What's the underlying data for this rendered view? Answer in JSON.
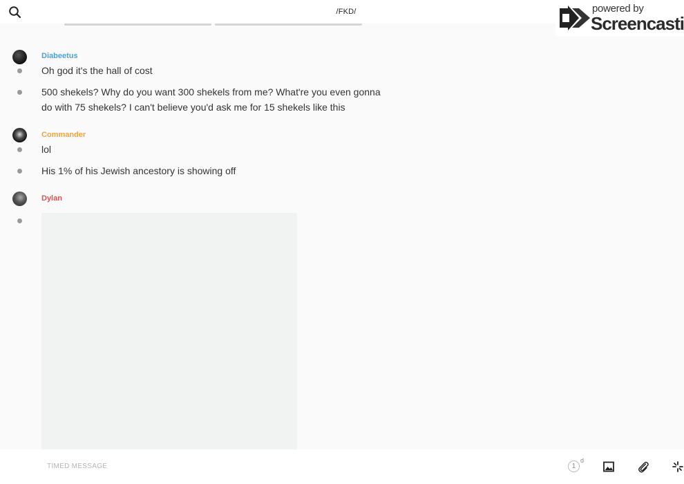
{
  "header": {
    "title": "/FKD/"
  },
  "watermark": {
    "line1": "powered by",
    "line2": "Screencastify"
  },
  "messages": {
    "groups": [
      {
        "sender": "Diabeetus",
        "color": "#4aa3d8",
        "items": [
          "Oh god it's the hall of cost",
          "500 shekels? Why do you want 300 shekels from me? What're you even gonna do with 75 shekels? I can't believe you'd ask me for 15 shekels like this"
        ]
      },
      {
        "sender": "Commander",
        "color": "#f0a43a",
        "items": [
          "lol",
          "His 1% of his Jewish ancestory is showing off"
        ]
      },
      {
        "sender": "Dylan",
        "color": "#d9534f",
        "items": []
      }
    ]
  },
  "footer": {
    "input_placeholder": "TIMED MESSAGE",
    "timer_value": "1",
    "timer_unit": "d"
  },
  "icons": {
    "search": "search-icon",
    "phone": "phone-icon",
    "info": "info-icon",
    "image": "image-icon",
    "attach": "paperclip-icon",
    "sparkle": "sparkle-icon"
  }
}
